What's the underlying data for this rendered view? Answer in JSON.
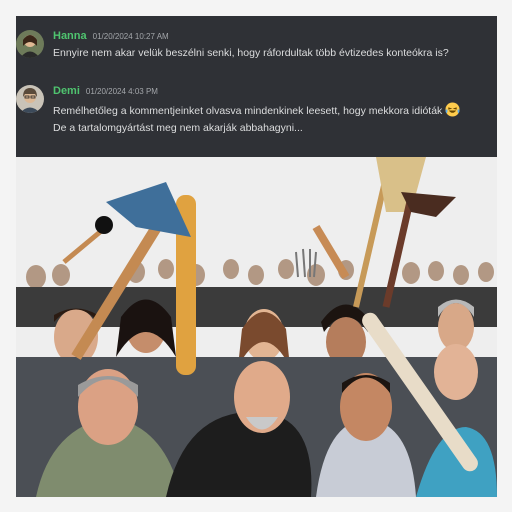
{
  "messages": [
    {
      "username": "Hanna",
      "timestamp": "01/20/2024 10:27 AM",
      "lines": [
        "Ennyire nem akar velük beszélni senki, hogy ráfordultak több évtizedes konteókra is?"
      ],
      "avatar_icon": "avatar-hanna"
    },
    {
      "username": "Demi",
      "timestamp": "01/20/2024 4:03 PM",
      "lines": [
        "Remélhetőleg a kommentjeinket olvasva mindenkinek leesett, hogy mekkora idióták",
        "De a tartalomgyártást meg nem akarják abbahagyni..."
      ],
      "emoji": "laughing-with-tears-emoji",
      "avatar_icon": "avatar-demi"
    }
  ],
  "colors": {
    "chat_background": "#2f3136",
    "username": "#4fc46f",
    "timestamp": "#a3a6aa",
    "message_text": "#dcddde"
  },
  "image": {
    "description_icon": "angry-crowd-photo"
  }
}
